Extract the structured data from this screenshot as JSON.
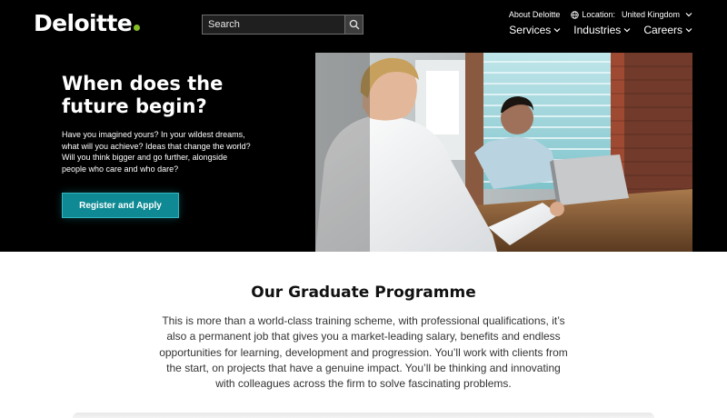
{
  "brand": {
    "name": "Deloitte",
    "dot_color": "#86bc25"
  },
  "search": {
    "placeholder": "Search",
    "icon": "search-icon"
  },
  "utility_nav": {
    "about": "About Deloitte",
    "location_label": "Location:",
    "location_value": "United Kingdom",
    "location_icon": "globe-icon"
  },
  "main_nav": {
    "items": [
      {
        "label": "Services"
      },
      {
        "label": "Industries"
      },
      {
        "label": "Careers"
      }
    ]
  },
  "hero": {
    "title": "When does the future begin?",
    "text": "Have you imagined yours? In your wildest dreams, what will you achieve? Ideas that change the world? Will you think bigger and go further, alongside people who care and who dare?",
    "cta_label": "Register and Apply",
    "cta_color": "#0f8a94"
  },
  "programme": {
    "title": "Our Graduate Programme",
    "text": "This is more than a world-class training scheme, with professional qualifications, it’s also a permanent job that gives you a market-leading salary, benefits and endless opportunities for learning, development and progression. You’ll work with clients from the start, on projects that have a genuine impact. You’ll be thinking and innovating with colleagues across the firm to solve fascinating problems."
  }
}
